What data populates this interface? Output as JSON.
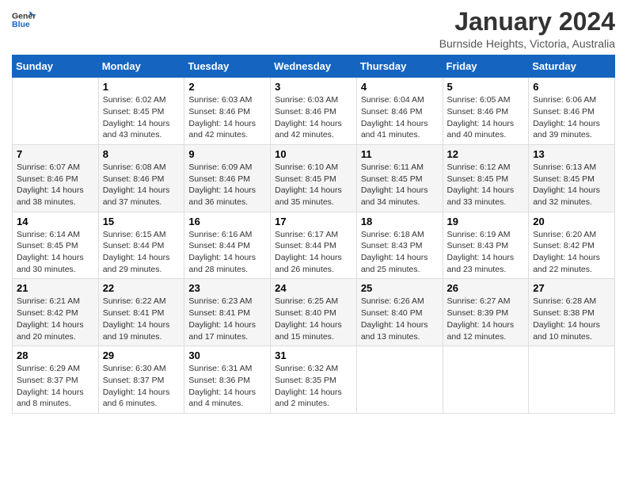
{
  "header": {
    "logo_general": "General",
    "logo_blue": "Blue",
    "title": "January 2024",
    "subtitle": "Burnside Heights, Victoria, Australia"
  },
  "calendar": {
    "headers": [
      "Sunday",
      "Monday",
      "Tuesday",
      "Wednesday",
      "Thursday",
      "Friday",
      "Saturday"
    ],
    "weeks": [
      [
        {
          "day": "",
          "sunrise": "",
          "sunset": "",
          "daylight": ""
        },
        {
          "day": "1",
          "sunrise": "Sunrise: 6:02 AM",
          "sunset": "Sunset: 8:45 PM",
          "daylight": "Daylight: 14 hours and 43 minutes."
        },
        {
          "day": "2",
          "sunrise": "Sunrise: 6:03 AM",
          "sunset": "Sunset: 8:46 PM",
          "daylight": "Daylight: 14 hours and 42 minutes."
        },
        {
          "day": "3",
          "sunrise": "Sunrise: 6:03 AM",
          "sunset": "Sunset: 8:46 PM",
          "daylight": "Daylight: 14 hours and 42 minutes."
        },
        {
          "day": "4",
          "sunrise": "Sunrise: 6:04 AM",
          "sunset": "Sunset: 8:46 PM",
          "daylight": "Daylight: 14 hours and 41 minutes."
        },
        {
          "day": "5",
          "sunrise": "Sunrise: 6:05 AM",
          "sunset": "Sunset: 8:46 PM",
          "daylight": "Daylight: 14 hours and 40 minutes."
        },
        {
          "day": "6",
          "sunrise": "Sunrise: 6:06 AM",
          "sunset": "Sunset: 8:46 PM",
          "daylight": "Daylight: 14 hours and 39 minutes."
        }
      ],
      [
        {
          "day": "7",
          "sunrise": "Sunrise: 6:07 AM",
          "sunset": "Sunset: 8:46 PM",
          "daylight": "Daylight: 14 hours and 38 minutes."
        },
        {
          "day": "8",
          "sunrise": "Sunrise: 6:08 AM",
          "sunset": "Sunset: 8:46 PM",
          "daylight": "Daylight: 14 hours and 37 minutes."
        },
        {
          "day": "9",
          "sunrise": "Sunrise: 6:09 AM",
          "sunset": "Sunset: 8:46 PM",
          "daylight": "Daylight: 14 hours and 36 minutes."
        },
        {
          "day": "10",
          "sunrise": "Sunrise: 6:10 AM",
          "sunset": "Sunset: 8:45 PM",
          "daylight": "Daylight: 14 hours and 35 minutes."
        },
        {
          "day": "11",
          "sunrise": "Sunrise: 6:11 AM",
          "sunset": "Sunset: 8:45 PM",
          "daylight": "Daylight: 14 hours and 34 minutes."
        },
        {
          "day": "12",
          "sunrise": "Sunrise: 6:12 AM",
          "sunset": "Sunset: 8:45 PM",
          "daylight": "Daylight: 14 hours and 33 minutes."
        },
        {
          "day": "13",
          "sunrise": "Sunrise: 6:13 AM",
          "sunset": "Sunset: 8:45 PM",
          "daylight": "Daylight: 14 hours and 32 minutes."
        }
      ],
      [
        {
          "day": "14",
          "sunrise": "Sunrise: 6:14 AM",
          "sunset": "Sunset: 8:45 PM",
          "daylight": "Daylight: 14 hours and 30 minutes."
        },
        {
          "day": "15",
          "sunrise": "Sunrise: 6:15 AM",
          "sunset": "Sunset: 8:44 PM",
          "daylight": "Daylight: 14 hours and 29 minutes."
        },
        {
          "day": "16",
          "sunrise": "Sunrise: 6:16 AM",
          "sunset": "Sunset: 8:44 PM",
          "daylight": "Daylight: 14 hours and 28 minutes."
        },
        {
          "day": "17",
          "sunrise": "Sunrise: 6:17 AM",
          "sunset": "Sunset: 8:44 PM",
          "daylight": "Daylight: 14 hours and 26 minutes."
        },
        {
          "day": "18",
          "sunrise": "Sunrise: 6:18 AM",
          "sunset": "Sunset: 8:43 PM",
          "daylight": "Daylight: 14 hours and 25 minutes."
        },
        {
          "day": "19",
          "sunrise": "Sunrise: 6:19 AM",
          "sunset": "Sunset: 8:43 PM",
          "daylight": "Daylight: 14 hours and 23 minutes."
        },
        {
          "day": "20",
          "sunrise": "Sunrise: 6:20 AM",
          "sunset": "Sunset: 8:42 PM",
          "daylight": "Daylight: 14 hours and 22 minutes."
        }
      ],
      [
        {
          "day": "21",
          "sunrise": "Sunrise: 6:21 AM",
          "sunset": "Sunset: 8:42 PM",
          "daylight": "Daylight: 14 hours and 20 minutes."
        },
        {
          "day": "22",
          "sunrise": "Sunrise: 6:22 AM",
          "sunset": "Sunset: 8:41 PM",
          "daylight": "Daylight: 14 hours and 19 minutes."
        },
        {
          "day": "23",
          "sunrise": "Sunrise: 6:23 AM",
          "sunset": "Sunset: 8:41 PM",
          "daylight": "Daylight: 14 hours and 17 minutes."
        },
        {
          "day": "24",
          "sunrise": "Sunrise: 6:25 AM",
          "sunset": "Sunset: 8:40 PM",
          "daylight": "Daylight: 14 hours and 15 minutes."
        },
        {
          "day": "25",
          "sunrise": "Sunrise: 6:26 AM",
          "sunset": "Sunset: 8:40 PM",
          "daylight": "Daylight: 14 hours and 13 minutes."
        },
        {
          "day": "26",
          "sunrise": "Sunrise: 6:27 AM",
          "sunset": "Sunset: 8:39 PM",
          "daylight": "Daylight: 14 hours and 12 minutes."
        },
        {
          "day": "27",
          "sunrise": "Sunrise: 6:28 AM",
          "sunset": "Sunset: 8:38 PM",
          "daylight": "Daylight: 14 hours and 10 minutes."
        }
      ],
      [
        {
          "day": "28",
          "sunrise": "Sunrise: 6:29 AM",
          "sunset": "Sunset: 8:37 PM",
          "daylight": "Daylight: 14 hours and 8 minutes."
        },
        {
          "day": "29",
          "sunrise": "Sunrise: 6:30 AM",
          "sunset": "Sunset: 8:37 PM",
          "daylight": "Daylight: 14 hours and 6 minutes."
        },
        {
          "day": "30",
          "sunrise": "Sunrise: 6:31 AM",
          "sunset": "Sunset: 8:36 PM",
          "daylight": "Daylight: 14 hours and 4 minutes."
        },
        {
          "day": "31",
          "sunrise": "Sunrise: 6:32 AM",
          "sunset": "Sunset: 8:35 PM",
          "daylight": "Daylight: 14 hours and 2 minutes."
        },
        {
          "day": "",
          "sunrise": "",
          "sunset": "",
          "daylight": ""
        },
        {
          "day": "",
          "sunrise": "",
          "sunset": "",
          "daylight": ""
        },
        {
          "day": "",
          "sunrise": "",
          "sunset": "",
          "daylight": ""
        }
      ]
    ]
  }
}
